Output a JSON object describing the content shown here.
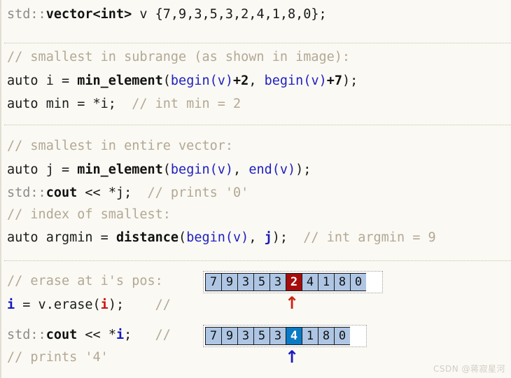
{
  "editor": {
    "background_color": "#faf9f4",
    "language": "cpp",
    "lines": [
      {
        "id": "line-declare-vector",
        "text": "std::vector<int> v {7,9,3,5,3,2,4,1,8,0};",
        "tokens": [
          {
            "t": "std::",
            "c": "gray"
          },
          {
            "t": "vector<int>",
            "c": "black"
          },
          {
            "t": " v {7,9,3,5,3,2,4,1,8,0};",
            "c": "plain"
          }
        ]
      },
      {
        "id": "line-comment-subrange",
        "text": "// smallest in subrange (as shown in image):",
        "tokens": [
          {
            "t": "// smallest in subrange (as shown in image):",
            "c": "comment"
          }
        ]
      },
      {
        "id": "line-min-element-subrange",
        "text": "auto i = min_element(begin(v)+2, begin(v)+7);",
        "tokens": [
          {
            "t": "auto i = ",
            "c": "plain"
          },
          {
            "t": "min_element",
            "c": "black"
          },
          {
            "t": "(",
            "c": "plain"
          },
          {
            "t": "begin",
            "c": "blue"
          },
          {
            "t": "(v)",
            "c": "blue"
          },
          {
            "t": "+2",
            "c": "num"
          },
          {
            "t": ", ",
            "c": "plain"
          },
          {
            "t": "begin",
            "c": "blue"
          },
          {
            "t": "(v)",
            "c": "blue"
          },
          {
            "t": "+7",
            "c": "num"
          },
          {
            "t": ");",
            "c": "plain"
          }
        ]
      },
      {
        "id": "line-auto-min",
        "text": "auto min = *i;  // int min = 2",
        "tokens": [
          {
            "t": "auto min = *i;",
            "c": "plain"
          },
          {
            "t": "  // int min = 2",
            "c": "comment"
          }
        ]
      },
      {
        "id": "line-comment-entire",
        "text": "// smallest in entire vector:",
        "tokens": [
          {
            "t": "// smallest in entire vector:",
            "c": "comment"
          }
        ]
      },
      {
        "id": "line-min-element-entire",
        "text": "auto j = min_element(begin(v), end(v));",
        "tokens": [
          {
            "t": "auto j = ",
            "c": "plain"
          },
          {
            "t": "min_element",
            "c": "black"
          },
          {
            "t": "(",
            "c": "plain"
          },
          {
            "t": "begin",
            "c": "blue"
          },
          {
            "t": "(v)",
            "c": "blue"
          },
          {
            "t": ", ",
            "c": "plain"
          },
          {
            "t": "end",
            "c": "blue"
          },
          {
            "t": "(v)",
            "c": "blue"
          },
          {
            "t": ");",
            "c": "plain"
          }
        ]
      },
      {
        "id": "line-cout-j",
        "text": "std::cout << *j;  // prints '0'",
        "tokens": [
          {
            "t": "std::",
            "c": "gray"
          },
          {
            "t": "cout",
            "c": "black"
          },
          {
            "t": " << *j;",
            "c": "plain"
          },
          {
            "t": "  // prints '0'",
            "c": "comment"
          }
        ]
      },
      {
        "id": "line-comment-index",
        "text": "// index of smallest:",
        "tokens": [
          {
            "t": "// index of smallest:",
            "c": "comment"
          }
        ]
      },
      {
        "id": "line-argmin",
        "text": "auto argmin = distance(begin(v), j);  // int argmin = 9",
        "tokens": [
          {
            "t": "auto argmin = ",
            "c": "plain"
          },
          {
            "t": "distance",
            "c": "black"
          },
          {
            "t": "(",
            "c": "plain"
          },
          {
            "t": "begin",
            "c": "blue"
          },
          {
            "t": "(v)",
            "c": "blue"
          },
          {
            "t": ", ",
            "c": "plain"
          },
          {
            "t": "j",
            "c": "navy"
          },
          {
            "t": ");",
            "c": "plain"
          },
          {
            "t": "  // int argmin = 9",
            "c": "comment"
          }
        ]
      },
      {
        "id": "line-comment-erase",
        "text": "// erase at i's pos:",
        "tokens": [
          {
            "t": "// erase at i's pos:",
            "c": "comment"
          }
        ]
      },
      {
        "id": "line-erase",
        "text": "i = v.erase(i);    //",
        "tokens": [
          {
            "t": "i",
            "c": "blueb"
          },
          {
            "t": " = v.erase(",
            "c": "plain"
          },
          {
            "t": "i",
            "c": "red"
          },
          {
            "t": ");",
            "c": "plain"
          },
          {
            "t": "    //",
            "c": "comment"
          }
        ]
      },
      {
        "id": "line-cout-i",
        "text": "std::cout << *i;   //",
        "tokens": [
          {
            "t": "std::",
            "c": "gray"
          },
          {
            "t": "cout",
            "c": "black"
          },
          {
            "t": " << *",
            "c": "plain"
          },
          {
            "t": "i",
            "c": "blueb"
          },
          {
            "t": ";",
            "c": "plain"
          },
          {
            "t": "   //",
            "c": "comment"
          }
        ]
      },
      {
        "id": "line-comment-prints4",
        "text": "// prints '4'",
        "tokens": [
          {
            "t": "// prints '4'",
            "c": "comment"
          }
        ]
      }
    ],
    "separators": [
      {
        "id": "separator-1"
      },
      {
        "id": "separator-2"
      },
      {
        "id": "separator-3"
      }
    ]
  },
  "diagrams": [
    {
      "id": "vector-before-erase",
      "caption_line": "// erase at i's pos:",
      "values": [
        "7",
        "9",
        "3",
        "5",
        "3",
        "2",
        "4",
        "1",
        "8",
        "0"
      ],
      "highlight_index": 5,
      "highlight_value": "2",
      "highlight_color": "#a50d0d",
      "cell_color": "#aec6e4",
      "arrow": {
        "id": "iterator-arrow-red",
        "glyph": "↑",
        "color": "#d21f0e",
        "points_at_index": 5
      }
    },
    {
      "id": "vector-after-erase",
      "caption_line": "std::cout << *i;",
      "values": [
        "7",
        "9",
        "3",
        "5",
        "3",
        "4",
        "1",
        "8",
        "0"
      ],
      "highlight_index": 5,
      "highlight_value": "4",
      "highlight_color": "#0a7ac4",
      "cell_color": "#aec6e4",
      "arrow": {
        "id": "iterator-arrow-blue",
        "glyph": "↑",
        "color": "#1a1ac0",
        "points_at_index": 5
      }
    }
  ],
  "watermark": {
    "text": "CSDN @蒋寂星河"
  }
}
